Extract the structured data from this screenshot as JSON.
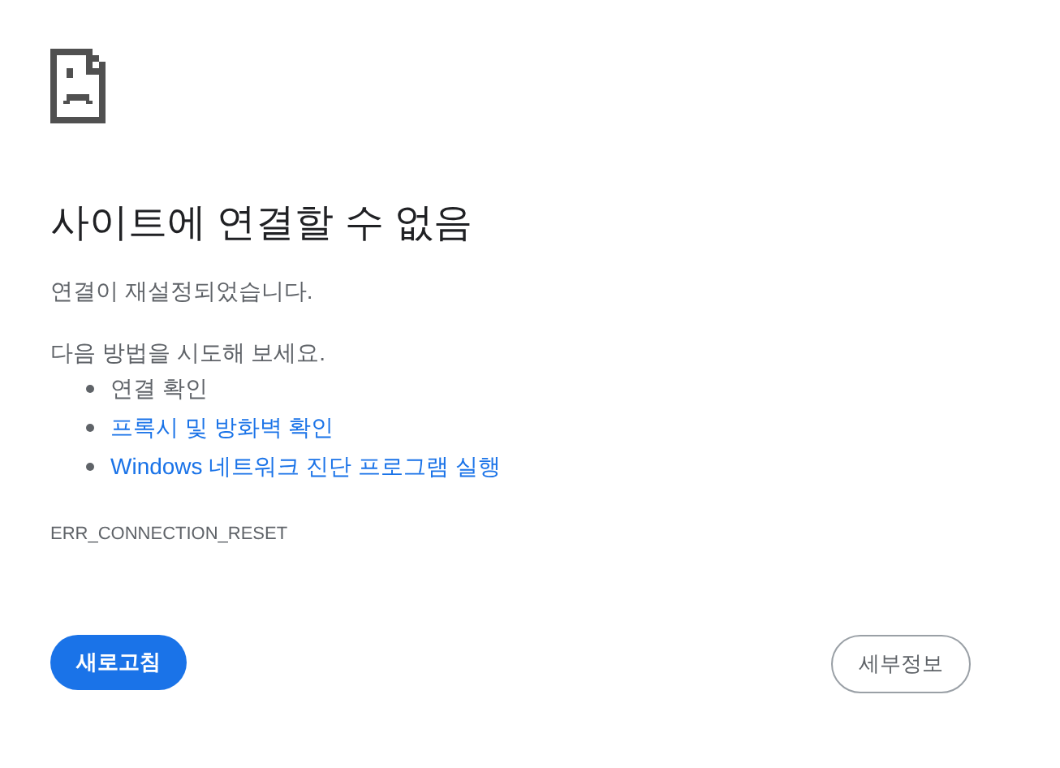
{
  "heading": "사이트에 연결할 수 없음",
  "summary": "연결이 재설정되었습니다.",
  "suggestions_intro": "다음 방법을 시도해 보세요.",
  "suggestions": [
    {
      "kind": "text",
      "label": "연결 확인"
    },
    {
      "kind": "link",
      "label": "프록시 및 방화벽 확인"
    },
    {
      "kind": "link",
      "label": "Windows 네트워크 진단 프로그램 실행"
    }
  ],
  "error_code": "ERR_CONNECTION_RESET",
  "buttons": [
    {
      "kind": "primary",
      "label": "새로고침"
    },
    {
      "kind": "secondary",
      "label": "세부정보"
    }
  ]
}
